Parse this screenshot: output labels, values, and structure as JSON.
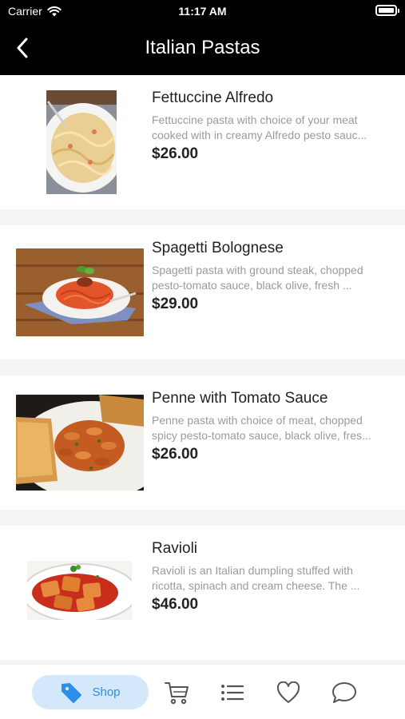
{
  "status_bar": {
    "carrier": "Carrier",
    "time": "11:17 AM"
  },
  "nav": {
    "title": "Italian Pastas"
  },
  "products": [
    {
      "name": "Fettuccine Alfredo",
      "desc_line1": "Fettuccine pasta with choice of your meat",
      "desc_line2": "cooked with in creamy Alfredo pesto sauc...",
      "price": "$26.00"
    },
    {
      "name": "Spagetti Bolognese",
      "desc_line1": "Spagetti pasta with ground steak, chopped",
      "desc_line2": "pesto-tomato sauce, black olive, fresh ...",
      "price": "$29.00"
    },
    {
      "name": "Penne with Tomato Sauce",
      "desc_line1": "Penne pasta with choice of meat, chopped",
      "desc_line2": "spicy pesto-tomato sauce, black olive, fres...",
      "price": "$26.00"
    },
    {
      "name": "Ravioli",
      "desc_line1": "Ravioli is an Italian dumpling stuffed with",
      "desc_line2": "ricotta, spinach and cream cheese. The ...",
      "price": "$46.00"
    }
  ],
  "tabbar": {
    "shop_label": "Shop"
  },
  "colors": {
    "header": "#000000",
    "accent": "#2c8ee6",
    "active_tab_bg": "#d3e9fb",
    "description": "#9a9a9a"
  }
}
